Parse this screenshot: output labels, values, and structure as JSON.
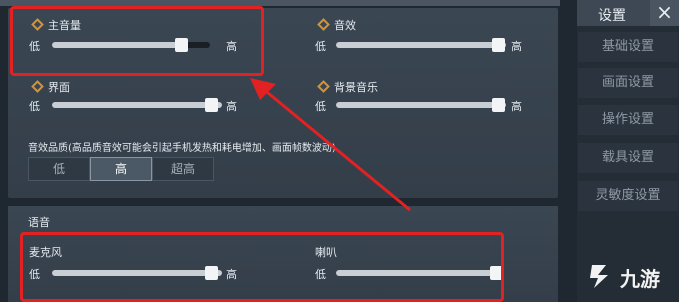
{
  "settings_panel": {
    "title": "设置",
    "close_symbol": "×",
    "items": [
      {
        "label": "基础设置"
      },
      {
        "label": "画面设置"
      },
      {
        "label": "操作设置"
      },
      {
        "label": "载具设置"
      },
      {
        "label": "灵敏度设置"
      }
    ]
  },
  "sliders": {
    "master": {
      "label": "主音量",
      "low": "低",
      "high": "高",
      "level": 0.82
    },
    "sfx": {
      "label": "音效",
      "low": "低",
      "high": "高",
      "level": 1.0
    },
    "ui": {
      "label": "界面",
      "low": "低",
      "high": "高",
      "level": 1.0
    },
    "bgm": {
      "label": "背景音乐",
      "low": "低",
      "high": "高",
      "level": 1.0
    },
    "mic": {
      "label": "麦克风",
      "low": "低",
      "high": "高",
      "level": 1.0
    },
    "speaker": {
      "label": "喇叭",
      "low": "低",
      "level": 1.0
    }
  },
  "quality": {
    "label": "音效品质(高品质音效可能会引起手机发热和耗电增加、画面帧数波动)",
    "options": [
      "低",
      "高",
      "超高"
    ],
    "selected": "高"
  },
  "voice": {
    "title": "语音"
  },
  "watermark": {
    "text": "九游"
  },
  "colors": {
    "highlight": "#e22222",
    "accent_icon": "#d9922d"
  }
}
